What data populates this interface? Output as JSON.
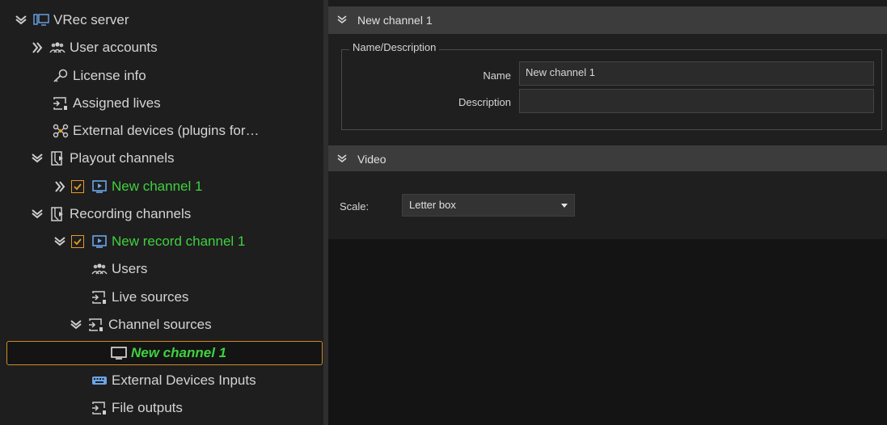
{
  "tree": {
    "root": "VRec server",
    "user_accounts": "User accounts",
    "license_info": "License info",
    "assigned_lives": "Assigned lives",
    "external_devices": "External devices (plugins for…",
    "playout_channels": "Playout channels",
    "playout_channel_1": "New channel 1",
    "recording_channels": "Recording channels",
    "record_channel_1": "New record channel 1",
    "users": "Users",
    "live_sources": "Live sources",
    "channel_sources": "Channel sources",
    "channel_source_1": "New channel 1",
    "external_devices_inputs": "External Devices Inputs",
    "file_outputs": "File outputs"
  },
  "colors": {
    "accent_orange": "#e39a27",
    "active_green": "#3fd13f",
    "icon_blue": "#6aa6e8"
  },
  "panel": {
    "section1_title": "New channel 1",
    "group_title": "Name/Description",
    "name_label": "Name",
    "name_value": "New channel 1",
    "description_label": "Description",
    "description_value": "",
    "section2_title": "Video",
    "scale_label": "Scale:",
    "scale_value": "Letter box"
  }
}
